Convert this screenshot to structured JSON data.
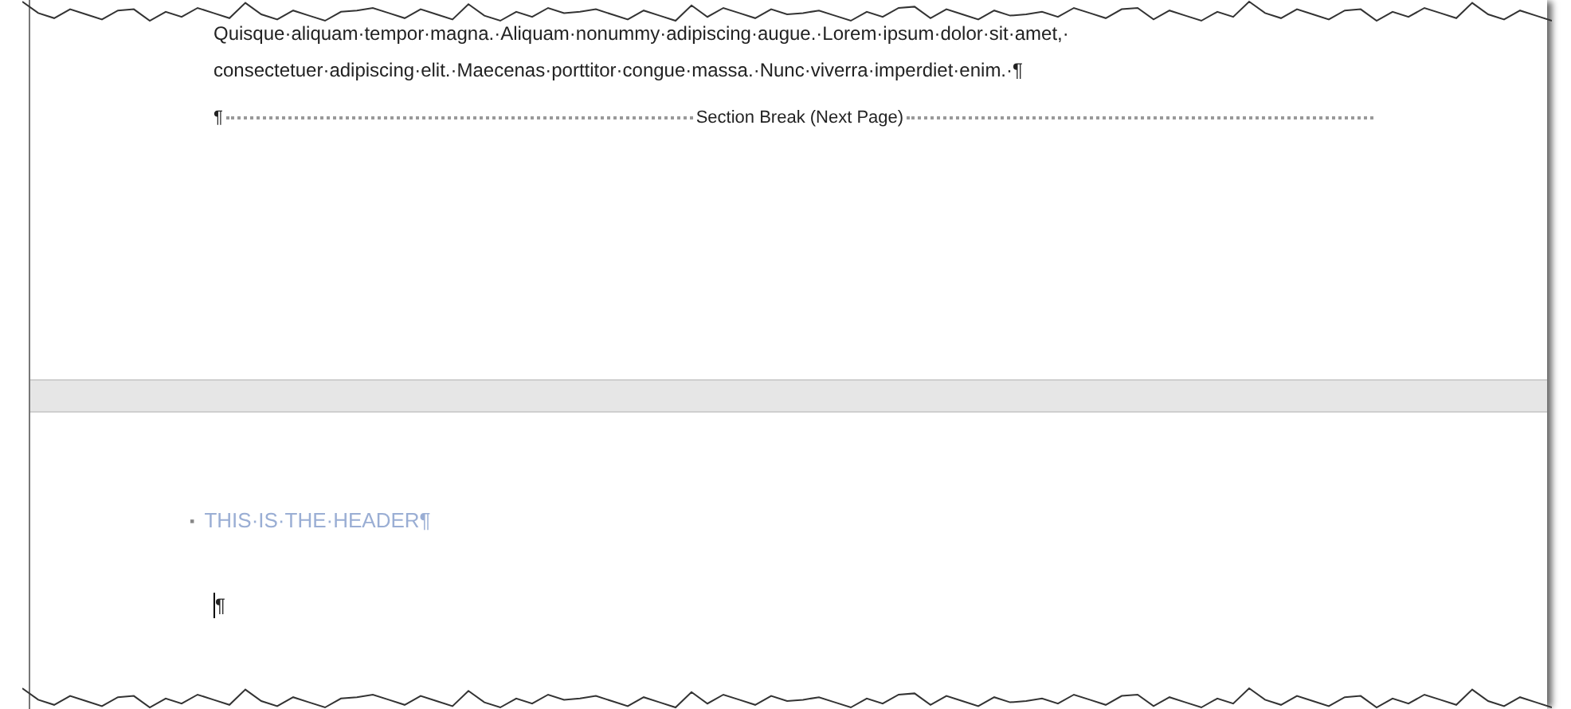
{
  "page_1": {
    "lines": [
      "Quisque·aliquam·tempor·magna.·Aliquam·nonummy·adipiscing·augue.·Lorem·ipsum·dolor·sit·amet,·",
      "consectetuer·adipiscing·elit.·Maecenas·porttitor·congue·massa.·Nunc·viverra·imperdiet·enim.·¶"
    ],
    "section_break": {
      "mark": "¶",
      "label": "Section Break (Next Page)"
    }
  },
  "page_2": {
    "header": {
      "bullet": "▪",
      "text": "THIS·IS·THE·HEADER¶"
    },
    "paragraph": "¶"
  }
}
